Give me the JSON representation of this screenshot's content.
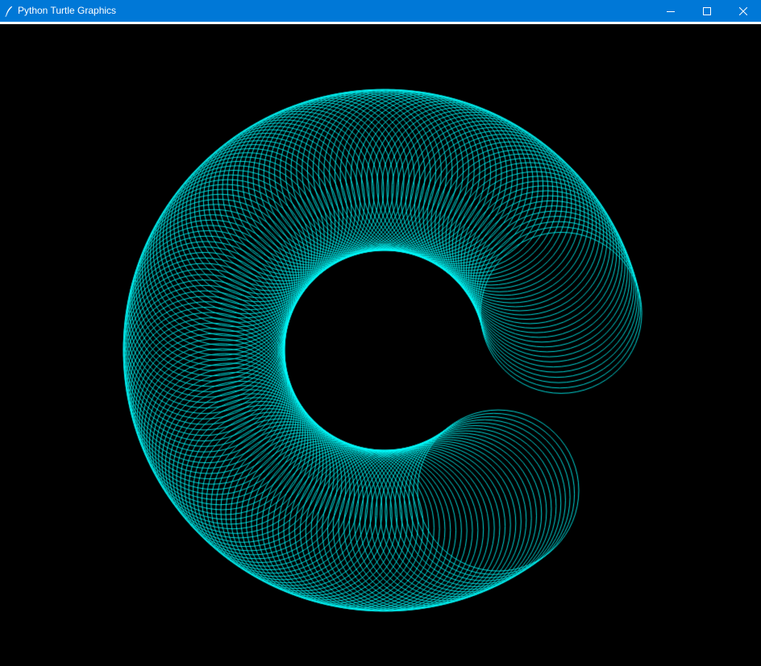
{
  "window": {
    "title": "Python Turtle Graphics",
    "titlebar_color": "#0078d7",
    "icons": {
      "app": "feather-pen-icon",
      "minimize": "minimize-icon",
      "maximize": "maximize-icon",
      "close": "close-icon"
    }
  },
  "canvas": {
    "background": "#000000",
    "pen_color": "#00ffff"
  }
}
